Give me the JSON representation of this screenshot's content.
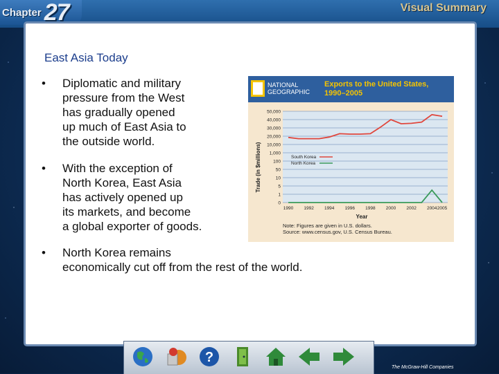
{
  "header": {
    "chapter_word": "Chapter",
    "chapter_number": "27",
    "section_label": "Visual Summary"
  },
  "slide": {
    "title": "East Asia Today",
    "bullets": [
      "Diplomatic and military\npressure from the West\nhas gradually opened\nup much of East Asia to\nthe outside world.",
      "With the exception of\nNorth Korea, East Asia\nhas actively opened up\nits markets, and become\na global exporter of goods.",
      "North Korea remains\neconomically cut off from the rest of the world."
    ]
  },
  "figure": {
    "brand_line1": "NATIONAL",
    "brand_line2": "GEOGRAPHIC",
    "title_line1": "Exports to the United States,",
    "title_line2": "1990–2005",
    "note_line1": "Note: Figures are given in U.S. dollars.",
    "note_line2": "Source: www.census.gov, U.S. Census Bureau."
  },
  "chart_data": {
    "type": "line",
    "title": "Exports to the United States, 1990–2005",
    "xlabel": "Year",
    "ylabel": "Trade (in $millions)",
    "y_scale": "broken (linear segments)",
    "y_ticks": [
      "0",
      "1",
      "5",
      "10",
      "50",
      "100",
      "1,000",
      "10,000",
      "20,000",
      "30,000",
      "40,000",
      "50,000"
    ],
    "x_ticks": [
      "1990",
      "1992",
      "1994",
      "1996",
      "1998",
      "2000",
      "2002",
      "2004",
      "2005"
    ],
    "x": [
      1990,
      1991,
      1992,
      1993,
      1994,
      1995,
      1996,
      1997,
      1998,
      1999,
      2000,
      2001,
      2002,
      2003,
      2004,
      2005
    ],
    "series": [
      {
        "name": "South Korea",
        "color": "#e0463c",
        "values": [
          18500,
          17000,
          17000,
          17000,
          19000,
          23000,
          22500,
          22500,
          23000,
          31000,
          40000,
          35000,
          35500,
          37000,
          46000,
          44000
        ]
      },
      {
        "name": "North Korea",
        "color": "#3a9a5a",
        "values": [
          0,
          0,
          0,
          0,
          0,
          0,
          0,
          0,
          0,
          0,
          0,
          0,
          0,
          0,
          3,
          0
        ]
      }
    ],
    "legend_position": "center-left",
    "grid": true
  },
  "nav": {
    "buttons": [
      "globe-icon",
      "shapes-icon",
      "help-icon",
      "exit-icon",
      "home-icon",
      "back-icon",
      "forward-icon"
    ]
  },
  "footer": {
    "publisher": "The McGraw-Hill Companies"
  },
  "colors": {
    "frame": "#164d87",
    "title": "#1b3d8c",
    "south_korea": "#e0463c",
    "north_korea": "#3a9a5a"
  }
}
